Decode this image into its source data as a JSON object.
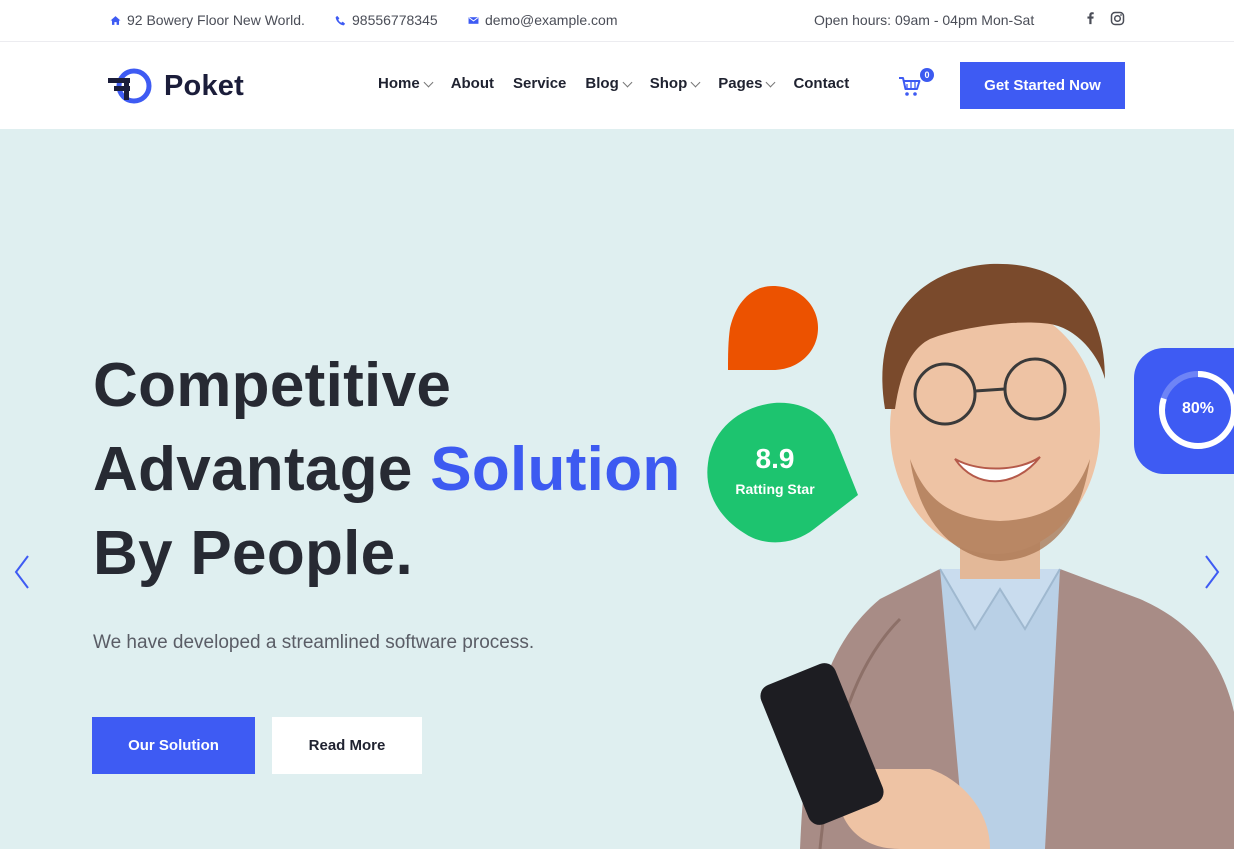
{
  "topbar": {
    "address": "92 Bowery Floor New World.",
    "phone": "98556778345",
    "email": "demo@example.com",
    "hours": "Open hours: 09am - 04pm Mon-Sat",
    "social": [
      "facebook-icon",
      "instagram-icon"
    ]
  },
  "header": {
    "brand": "Poket",
    "nav": [
      {
        "label": "Home",
        "dropdown": true
      },
      {
        "label": "About",
        "dropdown": false
      },
      {
        "label": "Service",
        "dropdown": false
      },
      {
        "label": "Blog",
        "dropdown": true
      },
      {
        "label": "Shop",
        "dropdown": true
      },
      {
        "label": "Pages",
        "dropdown": true
      },
      {
        "label": "Contact",
        "dropdown": false
      }
    ],
    "cart_count": "0",
    "cta_label": "Get Started Now"
  },
  "hero": {
    "title_line1": "Competitive",
    "title_line2_prefix": "Advantage ",
    "title_line2_accent": "Solution",
    "title_line3": "By People.",
    "subtitle": "We have developed a streamlined software process.",
    "primary_button": "Our Solution",
    "secondary_button": "Read More",
    "rating_value": "8.9",
    "rating_label": "Ratting Star",
    "progress_label": "80%",
    "progress_value": 0.8
  },
  "colors": {
    "accent": "#3e5bf3",
    "hero_bg": "#dfeff0",
    "green": "#1dc46f",
    "orange": "#ec5200"
  }
}
